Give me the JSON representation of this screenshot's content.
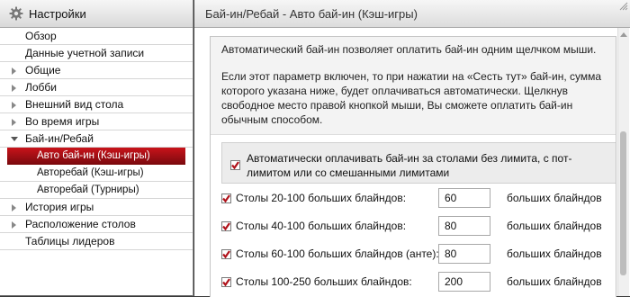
{
  "sidebar": {
    "title": "Настройки",
    "items": [
      {
        "label": "Обзор",
        "level": 0,
        "expander": "none"
      },
      {
        "label": "Данные учетной записи",
        "level": 0,
        "expander": "none"
      },
      {
        "label": "Общие",
        "level": 0,
        "expander": "collapsed"
      },
      {
        "label": "Лобби",
        "level": 0,
        "expander": "collapsed"
      },
      {
        "label": "Внешний вид стола",
        "level": 0,
        "expander": "collapsed"
      },
      {
        "label": "Во время игры",
        "level": 0,
        "expander": "collapsed"
      },
      {
        "label": "Бай-ин/Ребай",
        "level": 0,
        "expander": "expanded"
      },
      {
        "label": "Авто бай-ин (Кэш-игры)",
        "level": 1,
        "expander": "none",
        "active": true
      },
      {
        "label": "Авторебай (Кэш-игры)",
        "level": 1,
        "expander": "none"
      },
      {
        "label": "Авторебай (Турниры)",
        "level": 1,
        "expander": "none"
      },
      {
        "label": "История игры",
        "level": 0,
        "expander": "collapsed"
      },
      {
        "label": "Расположение столов",
        "level": 0,
        "expander": "collapsed"
      },
      {
        "label": "Таблицы лидеров",
        "level": 0,
        "expander": "none"
      }
    ]
  },
  "main": {
    "title": "Бай-ин/Ребай - Авто бай-ин (Кэш-игры)",
    "info_line1": "Автоматический бай-ин позволяет оплатить бай-ин одним щелчком мыши.",
    "info_line2": "Если этот параметр включен, то при нажатии на «Сесть тут» бай-ин, сумма которого указана ниже, будет оплачиваться автоматически. Щелкнув свободное место правой кнопкой мыши, Вы сможете оплатить бай-ин обычным способом.",
    "auto_checkbox_label": "Автоматически оплачивать бай-ин за столами без лимита, с пот-лимитом или со смешанными лимитами",
    "auto_checked": true,
    "rows": [
      {
        "label": "Столы 20-100 больших блайндов:",
        "value": "60",
        "unit": "больших блайндов",
        "checked": true
      },
      {
        "label": "Столы 40-100 больших блайндов:",
        "value": "80",
        "unit": "больших блайндов",
        "checked": true
      },
      {
        "label": "Столы 60-100 больших блайндов (анте):",
        "value": "80",
        "unit": "больших блайндов",
        "checked": true
      },
      {
        "label": "Столы 100-250 больших блайндов:",
        "value": "200",
        "unit": "больших блайндов",
        "checked": true
      }
    ]
  },
  "colors": {
    "active_item": "#b0121a",
    "checkmark": "#b0121a"
  },
  "icons": {
    "header": "gear-icon",
    "checkbox": "checkmark-icon",
    "collapsed": "triangle-right-icon",
    "expanded": "triangle-down-icon"
  }
}
